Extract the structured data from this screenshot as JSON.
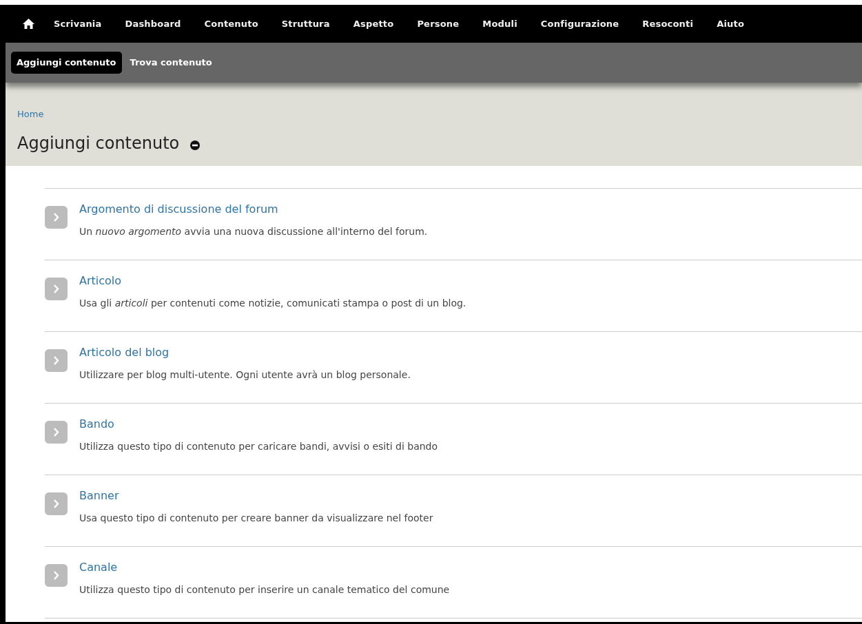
{
  "toolbar": {
    "items": [
      {
        "label": "Scrivania"
      },
      {
        "label": "Dashboard"
      },
      {
        "label": "Contenuto"
      },
      {
        "label": "Struttura"
      },
      {
        "label": "Aspetto"
      },
      {
        "label": "Persone"
      },
      {
        "label": "Moduli"
      },
      {
        "label": "Configurazione"
      },
      {
        "label": "Resoconti"
      },
      {
        "label": "Aiuto"
      }
    ]
  },
  "shortcuts": [
    {
      "label": "Aggiungi contenuto",
      "selected": true
    },
    {
      "label": "Trova contenuto",
      "selected": false
    }
  ],
  "breadcrumb": "Home",
  "page_title": "Aggiungi contenuto",
  "content_types": [
    {
      "title": "Argomento di discussione del forum",
      "description": "Un *nuovo argomento* avvia una nuova discussione all'interno del forum."
    },
    {
      "title": "Articolo",
      "description": "Usa gli *articoli* per contenuti come notizie, comunicati stampa o post di un blog."
    },
    {
      "title": "Articolo del blog",
      "description": "Utilizzare per blog multi-utente. Ogni utente avrà un blog personale."
    },
    {
      "title": "Bando",
      "description": "Utilizza questo tipo di contenuto per caricare bandi, avvisi o esiti di bando"
    },
    {
      "title": "Banner",
      "description": "Usa questo tipo di contenuto per creare banner da visualizzare nel footer"
    },
    {
      "title": "Canale",
      "description": "Utilizza questo tipo di contenuto per inserire un canale tematico del comune"
    }
  ]
}
